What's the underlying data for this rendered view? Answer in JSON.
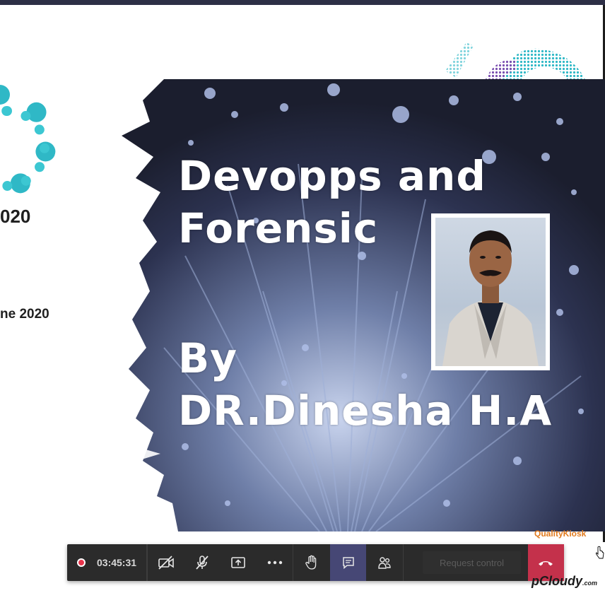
{
  "slide": {
    "title_line1": "Devopps and",
    "title_line2": "Forensic",
    "by_line1": "By",
    "by_line2": "DR.Dinesha H.A"
  },
  "previous_slide": {
    "year_text": "020",
    "date_text": "ne 2020"
  },
  "toolbar": {
    "recording_time": "03:45:31",
    "buttons": [
      {
        "name": "camera-off",
        "icon": "video-off-icon"
      },
      {
        "name": "mic-off",
        "icon": "mic-off-icon"
      },
      {
        "name": "share-screen",
        "icon": "share-tray-icon"
      },
      {
        "name": "more-actions",
        "icon": "ellipsis-icon"
      },
      {
        "name": "raise-hand",
        "icon": "hand-icon"
      },
      {
        "name": "chat",
        "icon": "chat-icon"
      },
      {
        "name": "participants",
        "icon": "people-icon"
      }
    ],
    "request_control_label": "Request control",
    "hangup_icon": "phone-hangup-icon"
  },
  "watermark": {
    "brand": "pCloudy",
    "brand_suffix": ".com",
    "partner": "QualityKiosk"
  },
  "colors": {
    "toolbar_bg": "#2b2b2b",
    "active_button": "#464775",
    "hangup": "#c4314b",
    "record_dot": "#e8344b",
    "accent_teal": "#2fb8c6"
  }
}
